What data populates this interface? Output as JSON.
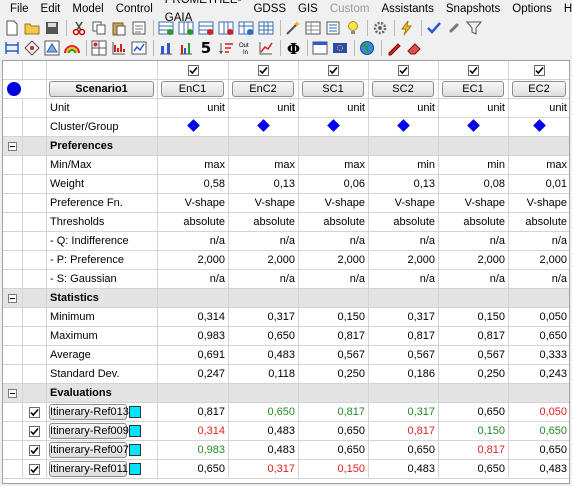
{
  "menu": [
    "File",
    "Edit",
    "Model",
    "Control",
    "PROMETHEE-GAIA",
    "GDSS",
    "GIS",
    "Custom",
    "Assistants",
    "Snapshots",
    "Options",
    "Help"
  ],
  "criteria": [
    "EnC1",
    "EnC2",
    "SC1",
    "SC2",
    "EC1",
    "EC2"
  ],
  "scenario": "Scenario1",
  "labels": {
    "unit": "Unit",
    "cluster": "Cluster/Group",
    "preferences": "Preferences",
    "minmax": "Min/Max",
    "weight": "Weight",
    "pref_fn": "Preference Fn.",
    "thresholds": "Thresholds",
    "q": "- Q: Indifference",
    "p": "- P: Preference",
    "s": "- S: Gaussian",
    "statistics": "Statistics",
    "minimum": "Minimum",
    "maximum": "Maximum",
    "average": "Average",
    "stddev": "Standard Dev.",
    "evaluations": "Evaluations",
    "toolbar_five": "5"
  },
  "unit_values": [
    "unit",
    "unit",
    "unit",
    "unit",
    "unit",
    "unit"
  ],
  "minmax_values": [
    "max",
    "max",
    "max",
    "min",
    "min",
    "max"
  ],
  "weight_values": [
    "0,58",
    "0,13",
    "0,06",
    "0,13",
    "0,08",
    "0,01"
  ],
  "pref_fn_values": [
    "V-shape",
    "V-shape",
    "V-shape",
    "V-shape",
    "V-shape",
    "V-shape"
  ],
  "threshold_values": [
    "absolute",
    "absolute",
    "absolute",
    "absolute",
    "absolute",
    "absolute"
  ],
  "q_values": [
    "n/a",
    "n/a",
    "n/a",
    "n/a",
    "n/a",
    "n/a"
  ],
  "p_values": [
    "2,000",
    "2,000",
    "2,000",
    "2,000",
    "2,000",
    "2,000"
  ],
  "s_values": [
    "n/a",
    "n/a",
    "n/a",
    "n/a",
    "n/a",
    "n/a"
  ],
  "stats": {
    "minimum": [
      "0,314",
      "0,317",
      "0,150",
      "0,317",
      "0,150",
      "0,050"
    ],
    "maximum": [
      "0,983",
      "0,650",
      "0,817",
      "0,817",
      "0,817",
      "0,650"
    ],
    "average": [
      "0,691",
      "0,483",
      "0,567",
      "0,567",
      "0,567",
      "0,333"
    ],
    "stddev": [
      "0,247",
      "0,118",
      "0,250",
      "0,186",
      "0,250",
      "0,243"
    ]
  },
  "alternatives": [
    {
      "name": "Itinerary-Ref013",
      "values": [
        "0,817",
        "0,650",
        "0,817",
        "0,317",
        "0,650",
        "0,050"
      ],
      "colors": [
        "",
        "green",
        "green",
        "green",
        "",
        "red"
      ]
    },
    {
      "name": "Itinerary-Ref009",
      "values": [
        "0,314",
        "0,483",
        "0,650",
        "0,817",
        "0,150",
        "0,650"
      ],
      "colors": [
        "red",
        "",
        "",
        "red",
        "green",
        "green"
      ]
    },
    {
      "name": "Itinerary-Ref007",
      "values": [
        "0,983",
        "0,483",
        "0,650",
        "0,650",
        "0,817",
        "0,650"
      ],
      "colors": [
        "green",
        "",
        "",
        "",
        "red",
        ""
      ]
    },
    {
      "name": "Itinerary-Ref011",
      "values": [
        "0,650",
        "0,317",
        "0,150",
        "0,483",
        "0,650",
        "0,483"
      ],
      "colors": [
        "",
        "red",
        "red",
        "",
        "",
        ""
      ]
    }
  ],
  "colors": {
    "accent_blue": "#0000ee",
    "swatch": "#00e5ff",
    "green": "#208a20",
    "red": "#e02020"
  }
}
